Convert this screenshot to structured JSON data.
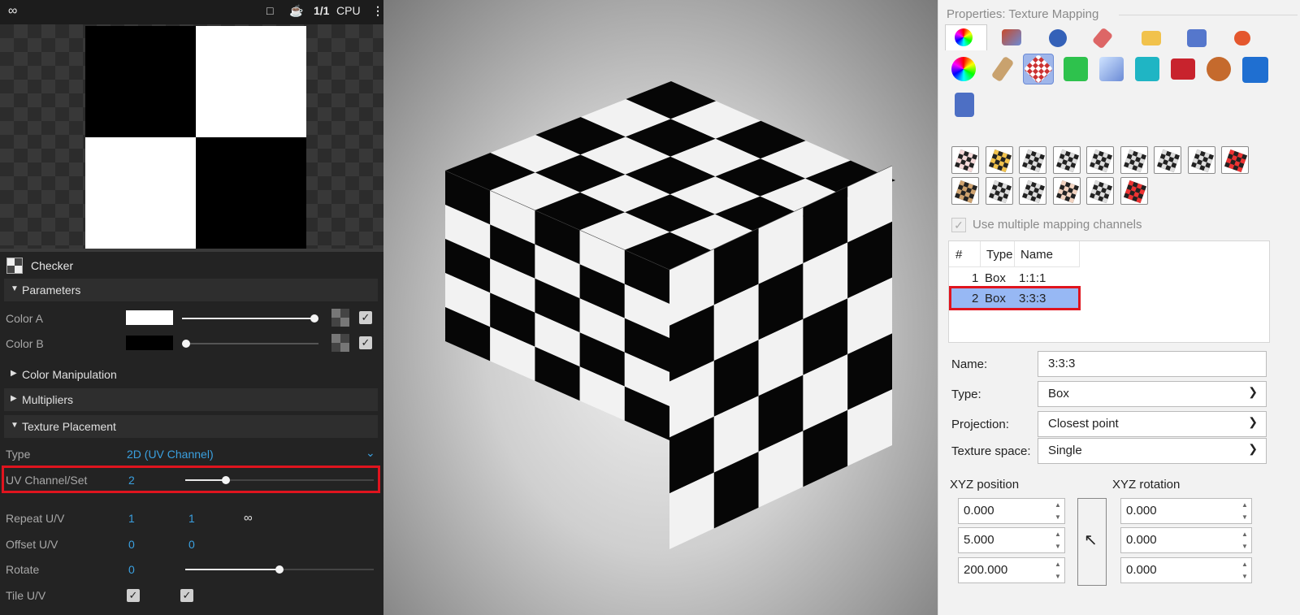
{
  "left_panel": {
    "toolbar": {
      "logo_icon": "link-icon",
      "items": [
        "□",
        "☕",
        "1/1",
        "CPU",
        "⋮"
      ]
    },
    "node_title": "Checker",
    "sections": {
      "parameters": "Parameters",
      "color_manipulation": "Color Manipulation",
      "multipliers": "Multipliers",
      "texture_placement": "Texture Placement"
    },
    "params": {
      "color_a": {
        "label": "Color A",
        "swatch": "#ffffff",
        "slider": 1.0
      },
      "color_b": {
        "label": "Color B",
        "swatch": "#000000",
        "slider": 0.0
      }
    },
    "placement": {
      "type_label": "Type",
      "type_value": "2D (UV Channel)",
      "uv_label": "UV Channel/Set",
      "uv_value": "2",
      "repeat_label": "Repeat U/V",
      "repeat_u": "1",
      "repeat_v": "1",
      "offset_label": "Offset U/V",
      "offset_u": "0",
      "offset_v": "0",
      "rotate_label": "Rotate",
      "rotate_value": "0",
      "tile_label": "Tile U/V"
    }
  },
  "right_panel": {
    "title": "Properties: Texture Mapping",
    "use_multiple_label": "Use multiple mapping channels",
    "table": {
      "headers": [
        "#",
        "Type",
        "Name"
      ],
      "rows": [
        {
          "num": "1",
          "type": "Box",
          "name": "1:1:1"
        },
        {
          "num": "2",
          "type": "Box",
          "name": "3:3:3"
        }
      ]
    },
    "form": {
      "name_label": "Name:",
      "name_value": "3:3:3",
      "type_label": "Type:",
      "type_value": "Box",
      "projection_label": "Projection:",
      "projection_value": "Closest point",
      "texspace_label": "Texture space:",
      "texspace_value": "Single"
    },
    "xyz_position_label": "XYZ position",
    "xyz_rotation_label": "XYZ rotation",
    "positions": [
      "0.000",
      "5.000",
      "200.000"
    ],
    "rotations": [
      "0.000",
      "0.000",
      "0.000"
    ]
  },
  "colors": {
    "highlight": "#e0141e",
    "accent": "#3aa0e0",
    "selected_row": "#97b8f4"
  }
}
